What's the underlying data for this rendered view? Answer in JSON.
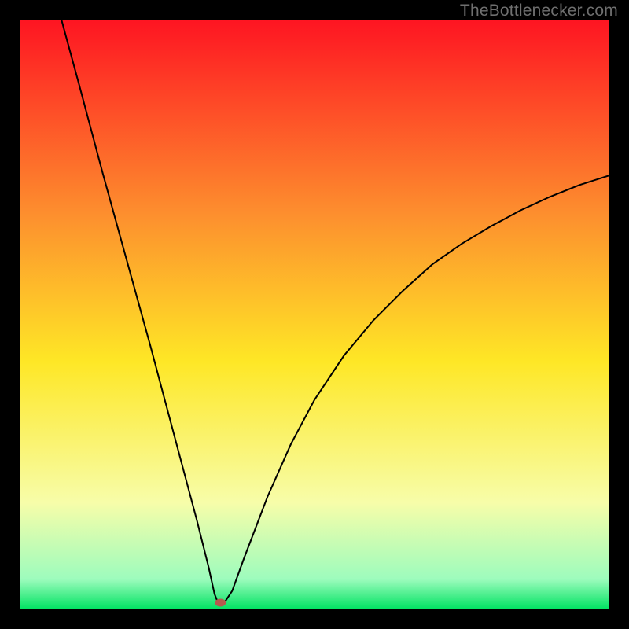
{
  "watermark": "TheBottlenecker.com",
  "colors": {
    "frame": "#000000",
    "gradient_top": "#fe1522",
    "gradient_mid_upper": "#fd8f2e",
    "gradient_mid": "#fee726",
    "gradient_lower": "#f7fda9",
    "gradient_band": "#9dfcbd",
    "gradient_bottom": "#04e364",
    "curve": "#000000",
    "marker": "#b6594e"
  },
  "chart_data": {
    "type": "line",
    "title": "",
    "xlabel": "",
    "ylabel": "",
    "xlim": [
      0,
      100
    ],
    "ylim": [
      0,
      100
    ],
    "marker": {
      "x": 34.0,
      "y": 1.0
    },
    "series": [
      {
        "name": "bottleneck-curve",
        "points": [
          {
            "x": 7.0,
            "y": 100.0
          },
          {
            "x": 10.0,
            "y": 89.0
          },
          {
            "x": 14.0,
            "y": 74.0
          },
          {
            "x": 18.0,
            "y": 59.5
          },
          {
            "x": 22.0,
            "y": 45.0
          },
          {
            "x": 26.0,
            "y": 30.0
          },
          {
            "x": 30.0,
            "y": 15.0
          },
          {
            "x": 32.0,
            "y": 7.0
          },
          {
            "x": 33.0,
            "y": 2.5
          },
          {
            "x": 33.5,
            "y": 1.2
          },
          {
            "x": 34.0,
            "y": 1.0
          },
          {
            "x": 34.8,
            "y": 1.2
          },
          {
            "x": 36.0,
            "y": 3.0
          },
          {
            "x": 38.0,
            "y": 8.5
          },
          {
            "x": 42.0,
            "y": 19.0
          },
          {
            "x": 46.0,
            "y": 28.0
          },
          {
            "x": 50.0,
            "y": 35.5
          },
          {
            "x": 55.0,
            "y": 43.0
          },
          {
            "x": 60.0,
            "y": 49.0
          },
          {
            "x": 65.0,
            "y": 54.0
          },
          {
            "x": 70.0,
            "y": 58.5
          },
          {
            "x": 75.0,
            "y": 62.0
          },
          {
            "x": 80.0,
            "y": 65.0
          },
          {
            "x": 85.0,
            "y": 67.7
          },
          {
            "x": 90.0,
            "y": 70.0
          },
          {
            "x": 95.0,
            "y": 72.0
          },
          {
            "x": 100.0,
            "y": 73.6
          }
        ]
      }
    ]
  }
}
